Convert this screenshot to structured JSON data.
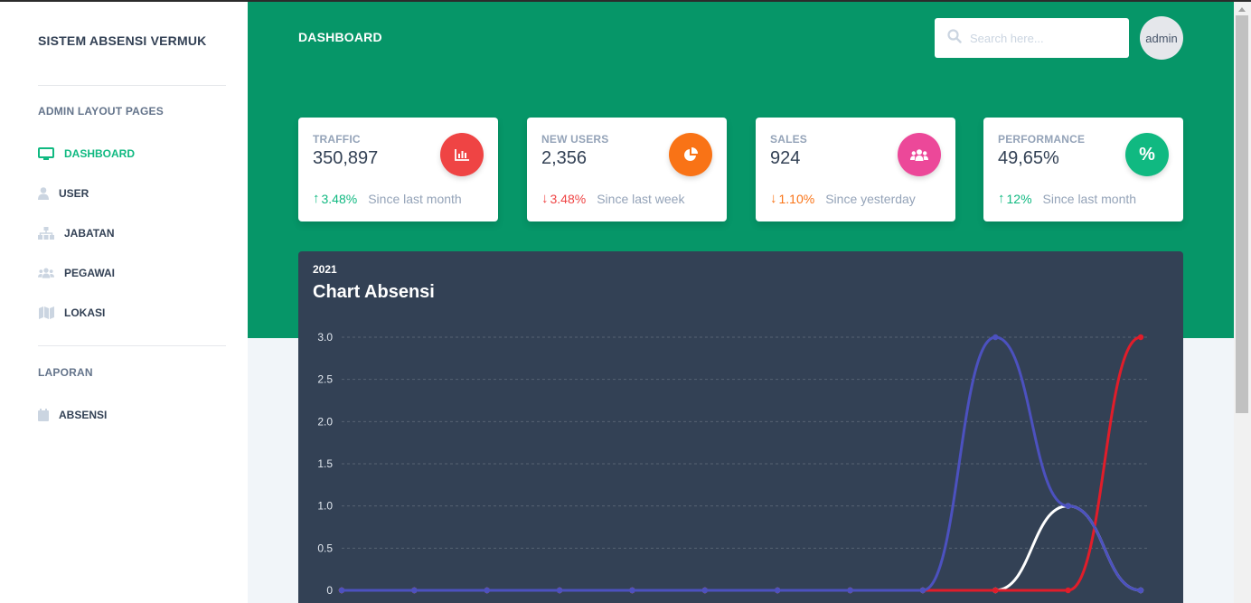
{
  "app": {
    "brand": "SISTEM ABSENSI VERMUK"
  },
  "sidebar": {
    "section_admin": "ADMIN LAYOUT PAGES",
    "items": [
      {
        "label": "DASHBOARD",
        "icon": "monitor-icon"
      },
      {
        "label": "USER",
        "icon": "user-icon"
      },
      {
        "label": "JABATAN",
        "icon": "sitemap-icon"
      },
      {
        "label": "PEGAWAI",
        "icon": "users-icon"
      },
      {
        "label": "LOKASI",
        "icon": "map-icon"
      }
    ],
    "section_report": "LAPORAN",
    "report_items": [
      {
        "label": "ABSENSI",
        "icon": "calendar-icon"
      }
    ]
  },
  "header": {
    "title": "DASHBOARD",
    "search_placeholder": "Search here...",
    "avatar_label": "admin"
  },
  "stats": [
    {
      "label": "TRAFFIC",
      "value": "350,897",
      "change": "3.48%",
      "direction": "up",
      "since": "Since last month",
      "icon": "bar-chart-icon",
      "color": "#ef4444",
      "change_color": "#10b981"
    },
    {
      "label": "NEW USERS",
      "value": "2,356",
      "change": "3.48%",
      "direction": "down",
      "since": "Since last week",
      "icon": "pie-chart-icon",
      "color": "#f97316",
      "change_color": "#ef4444"
    },
    {
      "label": "SALES",
      "value": "924",
      "change": "1.10%",
      "direction": "down",
      "since": "Since yesterday",
      "icon": "users-icon",
      "color": "#ec4899",
      "change_color": "#f97316"
    },
    {
      "label": "PERFORMANCE",
      "value": "49,65%",
      "change": "12%",
      "direction": "up",
      "since": "Since last month",
      "icon": "percent-icon",
      "color": "#10b981",
      "change_color": "#10b981"
    }
  ],
  "chart": {
    "subtitle": "2021",
    "title": "Chart Absensi"
  },
  "chart_data": {
    "type": "line",
    "ylim": [
      0,
      3
    ],
    "y_ticks": [
      "0",
      "0.5",
      "1.0",
      "1.5",
      "2.0",
      "2.5",
      "3.0"
    ],
    "grid": true,
    "points_count": 12,
    "series": [
      {
        "color": "#ffffff",
        "values": [
          0,
          0,
          0,
          0,
          0,
          0,
          0,
          0,
          0,
          0,
          1,
          0
        ]
      },
      {
        "color": "#e11d2a",
        "values": [
          0,
          0,
          0,
          0,
          0,
          0,
          0,
          0,
          0,
          0,
          0,
          3
        ]
      },
      {
        "color": "#4c51bf",
        "values": [
          0,
          0,
          0,
          0,
          0,
          0,
          0,
          0,
          0,
          3,
          1,
          0
        ]
      }
    ]
  }
}
